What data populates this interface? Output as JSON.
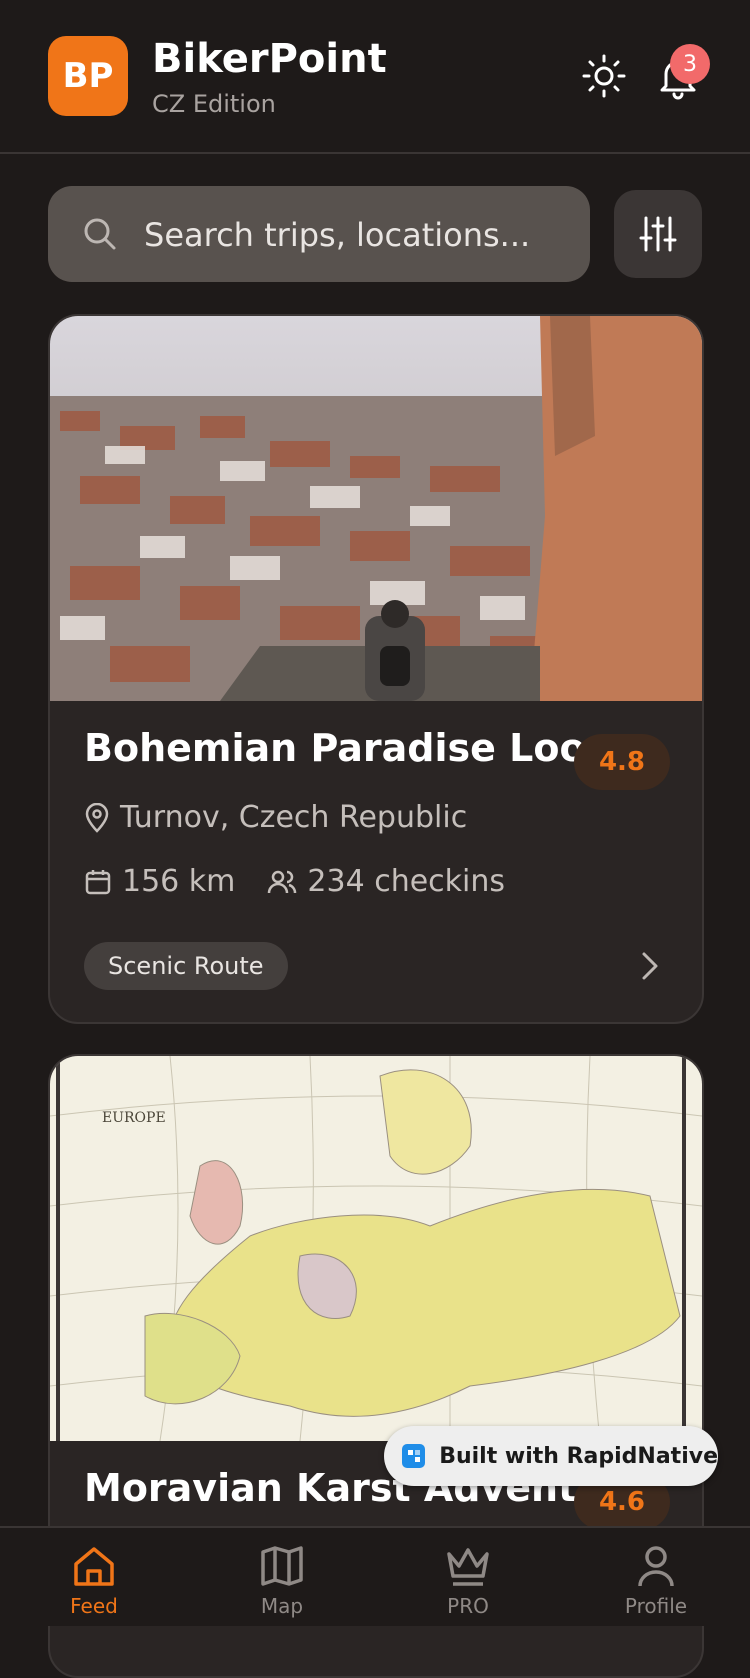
{
  "header": {
    "logo_text": "BP",
    "title": "BikerPoint",
    "subtitle": "CZ Edition",
    "notification_count": "3"
  },
  "search": {
    "placeholder": "Search trips, locations..."
  },
  "trips": [
    {
      "title": "Bohemian Paradise Loop",
      "rating": "4.8",
      "location": "Turnov, Czech Republic",
      "distance": "156 km",
      "checkins": "234 checkins",
      "tag": "Scenic Route",
      "image": "hilltop-town-photo"
    },
    {
      "title": "Moravian Karst Adventure",
      "rating": "4.6",
      "image": "europe-map-photo",
      "map_label": "EUROPE"
    }
  ],
  "toast": {
    "text": "Built with RapidNative"
  },
  "tabs": [
    {
      "label": "Feed",
      "icon": "home-icon",
      "active": true
    },
    {
      "label": "Map",
      "icon": "map-icon"
    },
    {
      "label": "PRO",
      "icon": "crown-icon"
    },
    {
      "label": "Profile",
      "icon": "user-icon"
    }
  ],
  "colors": {
    "accent": "#f07518",
    "background": "#1e1a19",
    "card": "#2a2524",
    "badge": "#f26a6a"
  }
}
